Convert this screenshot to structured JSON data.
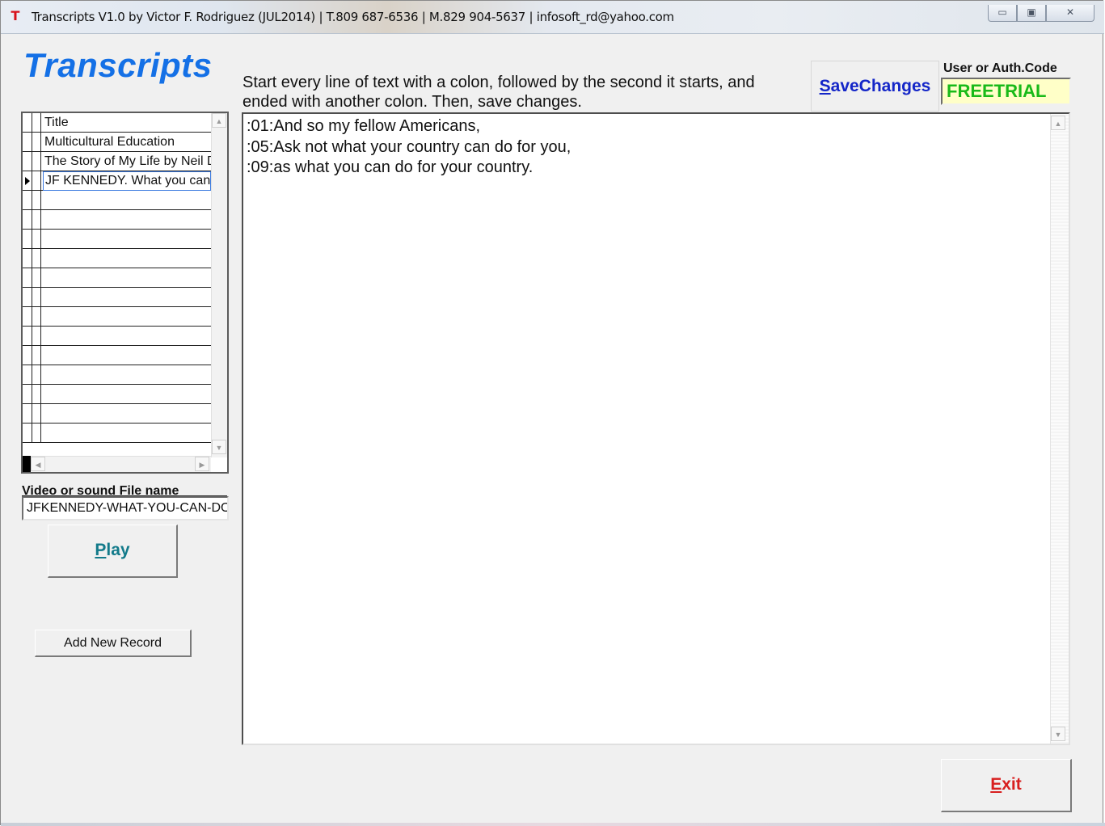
{
  "window": {
    "title": "Transcripts V1.0 by Victor F. Rodriguez (JUL2014) | T.809 687-6536 | M.829 904-5637 | infosoft_rd@yahoo.com",
    "app_icon_letter": "T",
    "controls": {
      "minimize": "▭",
      "maximize": "▣",
      "close": "✕"
    }
  },
  "header": {
    "app_title": "Transcripts",
    "instructions": "Start every line of text with a colon, followed by the second it starts, and ended with another colon. Then, save changes.",
    "save_button": {
      "accel": "S",
      "rest": "aveChanges"
    },
    "user_label": "User or Auth.Code",
    "user_value": "FREETRIAL"
  },
  "records": {
    "column_header": "Title",
    "rows": [
      "Multicultural Education",
      "The Story of My Life by Neil D",
      "JF KENNEDY. What you can"
    ],
    "active_row_index": 2,
    "empty_rows": 13
  },
  "file": {
    "label": "Video or sound File name",
    "value": "JFKENNEDY-WHAT-YOU-CAN-DO"
  },
  "buttons": {
    "play": {
      "accel": "P",
      "rest": "lay"
    },
    "add_new_record": "Add New Record",
    "exit": {
      "accel": "E",
      "rest": "xit"
    }
  },
  "transcript": {
    "lines": [
      ":01:And so my fellow Americans,",
      ":05:Ask not what your country can do for you,",
      ":09:as what you can do for your country."
    ]
  },
  "colors": {
    "title_blue": "#1470e6",
    "save_blue": "#1426c8",
    "freetrial_green": "#19ba19",
    "freetrial_bg": "#ffffc8",
    "play_teal": "#127a8a",
    "exit_red": "#d81f1f"
  }
}
